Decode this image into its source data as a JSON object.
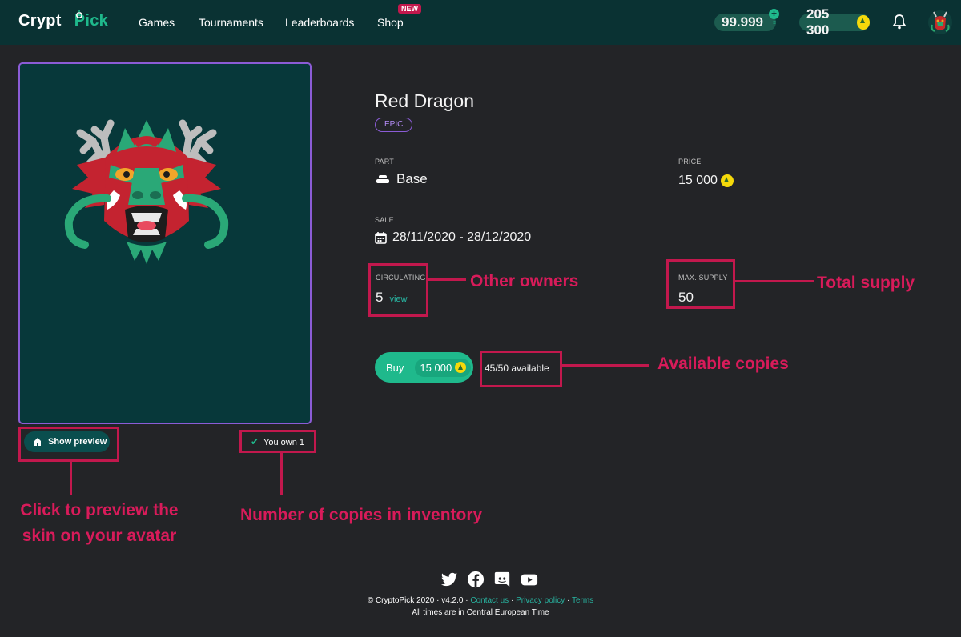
{
  "brand": {
    "word1": "Crypt",
    "word2": "Pick"
  },
  "nav": {
    "games": "Games",
    "tournaments": "Tournaments",
    "leaderboards": "Leaderboards",
    "shop": "Shop",
    "shop_badge": "NEW"
  },
  "wallet": {
    "currency1": "99.999",
    "currency2": "205 300"
  },
  "item": {
    "name": "Red Dragon",
    "rarity": "EPIC",
    "part_label": "PART",
    "part_value": "Base",
    "price_label": "PRICE",
    "price_value": "15 000",
    "sale_label": "SALE",
    "sale_value": "28/11/2020 - 28/12/2020",
    "circulating_label": "CIRCULATING",
    "circulating_value": "5",
    "view_link": "view",
    "max_supply_label": "MAX. SUPPLY",
    "max_supply_value": "50",
    "buy_label": "Buy",
    "buy_price": "15 000",
    "available": "45/50 available",
    "show_preview": "Show preview",
    "you_own": "You own 1"
  },
  "annotations": {
    "other_owners": "Other owners",
    "total_supply": "Total supply",
    "available_copies": "Available copies",
    "preview_line1": "Click to preview the",
    "preview_line2": "skin on your avatar",
    "inventory": "Number of copies in inventory"
  },
  "footer": {
    "copyright": "© CryptoPick 2020 · v4.2.0 ·",
    "contact": "Contact us",
    "privacy": "Privacy policy",
    "terms": "Terms",
    "sep": "·",
    "timezone": "All times are in Central European Time"
  },
  "colors": {
    "accent": "#1fb98c",
    "header": "#0a3233",
    "annotation": "#c2184d",
    "epic": "#8b5cd6"
  }
}
